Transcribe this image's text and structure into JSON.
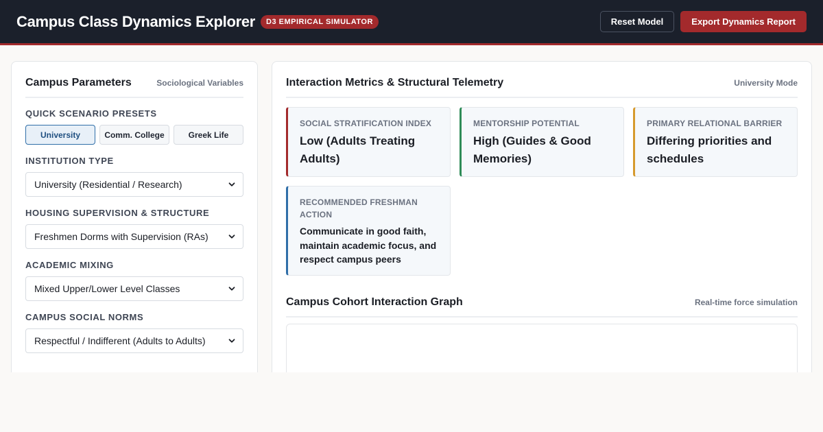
{
  "header": {
    "title": "Campus Class Dynamics Explorer",
    "badge": "D3 EMPIRICAL SIMULATOR",
    "reset_label": "Reset Model",
    "export_label": "Export Dynamics Report"
  },
  "sidebar": {
    "title": "Campus Parameters",
    "subtitle": "Sociological Variables",
    "presets_label": "QUICK SCENARIO PRESETS",
    "presets": [
      "University",
      "Comm. College",
      "Greek Life"
    ],
    "active_preset": "University",
    "fields": [
      {
        "label": "INSTITUTION TYPE",
        "value": "University (Residential / Research)"
      },
      {
        "label": "HOUSING SUPERVISION & STRUCTURE",
        "value": "Freshmen Dorms with Supervision (RAs)"
      },
      {
        "label": "ACADEMIC MIXING",
        "value": "Mixed Upper/Lower Level Classes"
      },
      {
        "label": "CAMPUS SOCIAL NORMS",
        "value": "Respectful / Indifferent (Adults to Adults)"
      }
    ]
  },
  "main": {
    "title": "Interaction Metrics & Structural Telemetry",
    "mode": "University Mode",
    "metrics": [
      {
        "label": "SOCIAL STRATIFICATION INDEX",
        "value": "Low (Adults Treating Adults)"
      },
      {
        "label": "MENTORSHIP POTENTIAL",
        "value": "High (Guides & Good Memories)"
      },
      {
        "label": "PRIMARY RELATIONAL BARRIER",
        "value": "Differing priorities and schedules"
      },
      {
        "label": "RECOMMENDED FRESHMAN ACTION",
        "value": "Communicate in good faith, maintain academic focus, and respect campus peers"
      }
    ],
    "graph_title": "Campus Cohort Interaction Graph",
    "graph_subtitle": "Real-time force simulation"
  },
  "colors": {
    "topbar": "#1b202b",
    "accent": "#a32a2c",
    "green": "#2e8b57",
    "amber": "#d69a2e",
    "blue": "#2f6ea8"
  },
  "icons": [
    "chevron-down-icon"
  ]
}
